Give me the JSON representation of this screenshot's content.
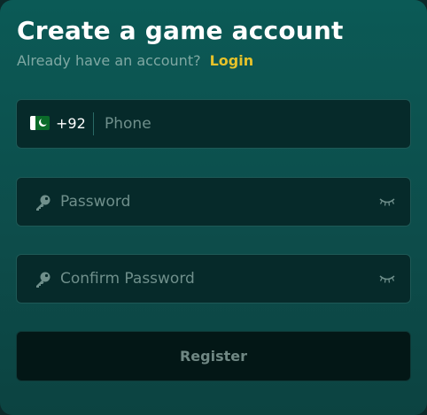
{
  "header": {
    "title": "Create a game account",
    "subtitle_text": "Already have an account?",
    "login_link": "Login"
  },
  "form": {
    "phone": {
      "country_code": "+92",
      "placeholder": "Phone",
      "value": "",
      "flag_icon": "pakistan-flag-icon"
    },
    "password": {
      "placeholder": "Password",
      "value": "",
      "icon": "key-icon",
      "toggle_icon": "eye-closed-icon"
    },
    "confirm_password": {
      "placeholder": "Confirm Password",
      "value": "",
      "icon": "key-icon",
      "toggle_icon": "eye-closed-icon"
    },
    "register_label": "Register"
  },
  "colors": {
    "accent_link": "#e6c22a",
    "panel_background": "#0b5a56",
    "field_background": "#062a2a",
    "button_background": "#031716"
  }
}
